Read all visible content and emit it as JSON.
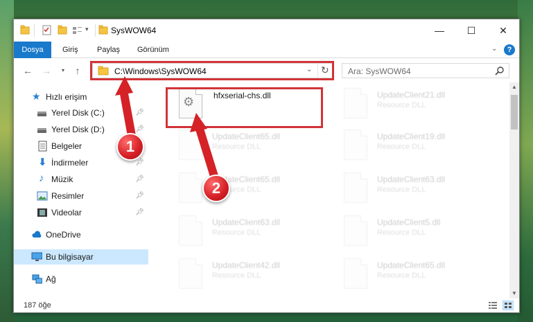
{
  "window": {
    "title": "SysWOW64",
    "controls": {
      "minimize": "—",
      "maximize": "☐",
      "close": "✕"
    }
  },
  "ribbon": {
    "tabs": [
      "Dosya",
      "Giriş",
      "Paylaş",
      "Görünüm"
    ],
    "help_label": "?"
  },
  "address": {
    "path": "C:\\Windows\\SysWOW64",
    "search_placeholder": "Ara: SysWOW64"
  },
  "sidebar": {
    "items": [
      {
        "label": "Hızlı erişim",
        "icon": "star-icon",
        "pinned": false
      },
      {
        "label": "Yerel Disk (C:)",
        "icon": "drive-icon",
        "pinned": true
      },
      {
        "label": "Yerel Disk (D:)",
        "icon": "drive-icon",
        "pinned": true
      },
      {
        "label": "Belgeler",
        "icon": "documents-icon",
        "pinned": true
      },
      {
        "label": "İndirmeler",
        "icon": "download-icon",
        "pinned": true
      },
      {
        "label": "Müzik",
        "icon": "music-icon",
        "pinned": true
      },
      {
        "label": "Resimler",
        "icon": "pictures-icon",
        "pinned": true
      },
      {
        "label": "Videolar",
        "icon": "video-icon",
        "pinned": true
      },
      {
        "label": "OneDrive",
        "icon": "cloud-icon",
        "pinned": false
      },
      {
        "label": "Bu bilgisayar",
        "icon": "computer-icon",
        "pinned": false
      },
      {
        "label": "Ağ",
        "icon": "network-icon",
        "pinned": false
      }
    ]
  },
  "files": {
    "highlighted": {
      "name": "hfxserial-chs.dll",
      "type": ""
    },
    "column1": [
      {
        "name": "UpdateClient65.dll",
        "type": "Resource DLL"
      },
      {
        "name": "UpdateClient65.dll",
        "type": "Resource DLL"
      },
      {
        "name": "UpdateClient63.dll",
        "type": "Resource DLL"
      },
      {
        "name": "UpdateClient42.dll",
        "type": "Resource DLL"
      }
    ],
    "column2": [
      {
        "name": "UpdateClient21.dll",
        "type": "Resource DLL"
      },
      {
        "name": "UpdateClient19.dll",
        "type": "Resource DLL"
      },
      {
        "name": "UpdateClient63.dll",
        "type": "Resource DLL"
      },
      {
        "name": "UpdateClient5.dll",
        "type": "Resource DLL"
      },
      {
        "name": "UpdateClient65.dll",
        "type": "Resource DLL"
      }
    ]
  },
  "status": {
    "count": "187 öğe"
  },
  "annotations": {
    "step1": "1",
    "step2": "2"
  },
  "colors": {
    "accent": "#1979ca",
    "highlight": "#d23338",
    "selected": "#cce8ff"
  }
}
